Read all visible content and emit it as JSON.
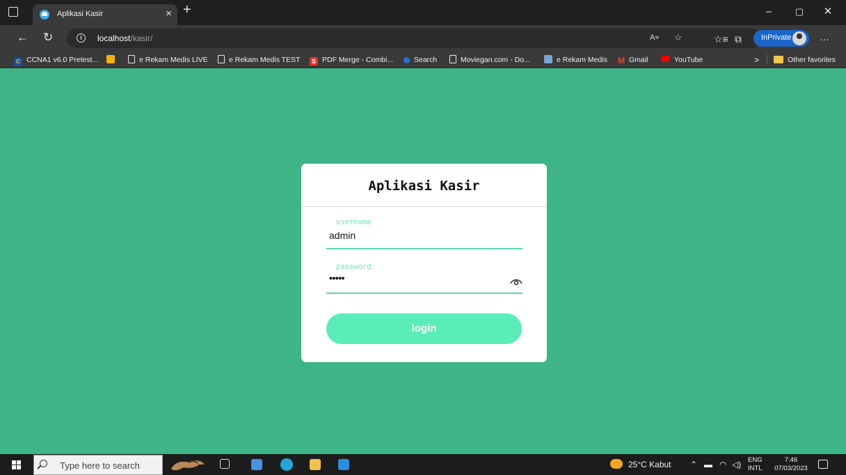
{
  "browser": {
    "tab_title": "Aplikasi Kasir",
    "tab_close": "×",
    "new_tab": "+",
    "window_controls": {
      "minimize": "–",
      "restore": "▢",
      "close": "✕"
    },
    "url_host": "localhost",
    "url_path": "/kasir/",
    "inprivate_label": "InPrivate",
    "more_label": "···"
  },
  "favorites": {
    "items": [
      {
        "label": "CCNA1 v6.0 Pretest...",
        "icon": "ccna-icon"
      },
      {
        "label": "",
        "icon": "mail-icon"
      },
      {
        "label": "e Rekam Medis LIVE",
        "icon": "page-icon"
      },
      {
        "label": "e Rekam Medis TEST",
        "icon": "page-icon"
      },
      {
        "label": "PDF Merge - Combi...",
        "icon": "pdf-icon"
      },
      {
        "label": "Search",
        "icon": "search-icon"
      },
      {
        "label": "Moviegan.com - Do...",
        "icon": "page-icon"
      },
      {
        "label": "e Rekam Medis",
        "icon": "erm-icon"
      },
      {
        "label": "Gmail",
        "icon": "gmail-icon"
      },
      {
        "label": "YouTube",
        "icon": "youtube-icon"
      }
    ],
    "overflow": ">",
    "other_favorites": "Other favorites"
  },
  "login": {
    "title": "Aplikasi Kasir",
    "username_label": "username",
    "username_value": "admin",
    "password_label": "password",
    "password_value": "•••••",
    "button_label": "login"
  },
  "taskbar": {
    "search_placeholder": "Type here to search",
    "weather": "25°C Kabut",
    "lang_1": "ENG",
    "lang_2": "INTL",
    "time": "7:46",
    "date": "07/03/2023"
  },
  "colors": {
    "page_background": "#3db586",
    "accent": "#5bedb8",
    "underline": "#5ad6ad"
  }
}
